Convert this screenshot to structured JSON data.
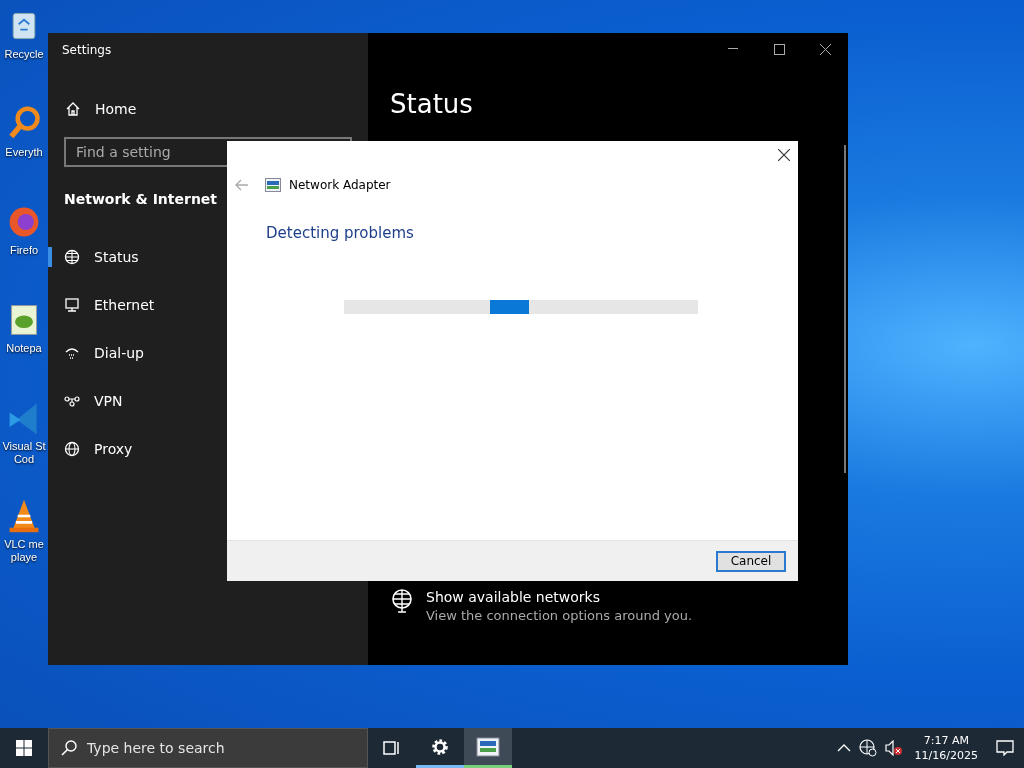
{
  "desktop_icons": [
    {
      "kind": "recycle",
      "lines": [
        "Recycle"
      ]
    },
    {
      "kind": "search",
      "lines": [
        "Everyth"
      ]
    },
    {
      "kind": "browser",
      "lines": [
        "Firefo"
      ]
    },
    {
      "kind": "notepad",
      "lines": [
        "Notepa"
      ]
    },
    {
      "kind": "code",
      "lines": [
        "Visual St",
        "Cod"
      ]
    },
    {
      "kind": "cone",
      "lines": [
        "VLC me",
        "playe"
      ]
    }
  ],
  "settings_window": {
    "title": "Settings",
    "home": "Home",
    "search": {
      "placeholder": "Find a setting"
    },
    "section": "Network & Internet",
    "nav": [
      {
        "kind": "globe",
        "label": "Status",
        "selected": true
      },
      {
        "kind": "ethernet",
        "label": "Ethernet",
        "selected": false
      },
      {
        "kind": "dialup",
        "label": "Dial-up",
        "selected": false
      },
      {
        "kind": "vpn",
        "label": "VPN",
        "selected": false
      },
      {
        "kind": "proxy",
        "label": "Proxy",
        "selected": false
      }
    ],
    "page_title": "Status",
    "link": {
      "title": "Show available networks",
      "subtitle": "View the connection options around you."
    }
  },
  "dialog": {
    "breadcrumb": "Network Adapter",
    "heading": "Detecting problems",
    "progress": {
      "indeterminate": true
    },
    "buttons": [
      "Cancel"
    ]
  },
  "taskbar": {
    "search": {
      "placeholder": "Type here to search"
    },
    "apps": [
      {
        "kind": "taskview",
        "running": false,
        "selected": false
      },
      {
        "kind": "gear",
        "running": true,
        "selected": false
      },
      {
        "kind": "adapter",
        "running": true,
        "selected": true
      }
    ],
    "time": "7:17 AM",
    "date": "11/16/2025"
  }
}
